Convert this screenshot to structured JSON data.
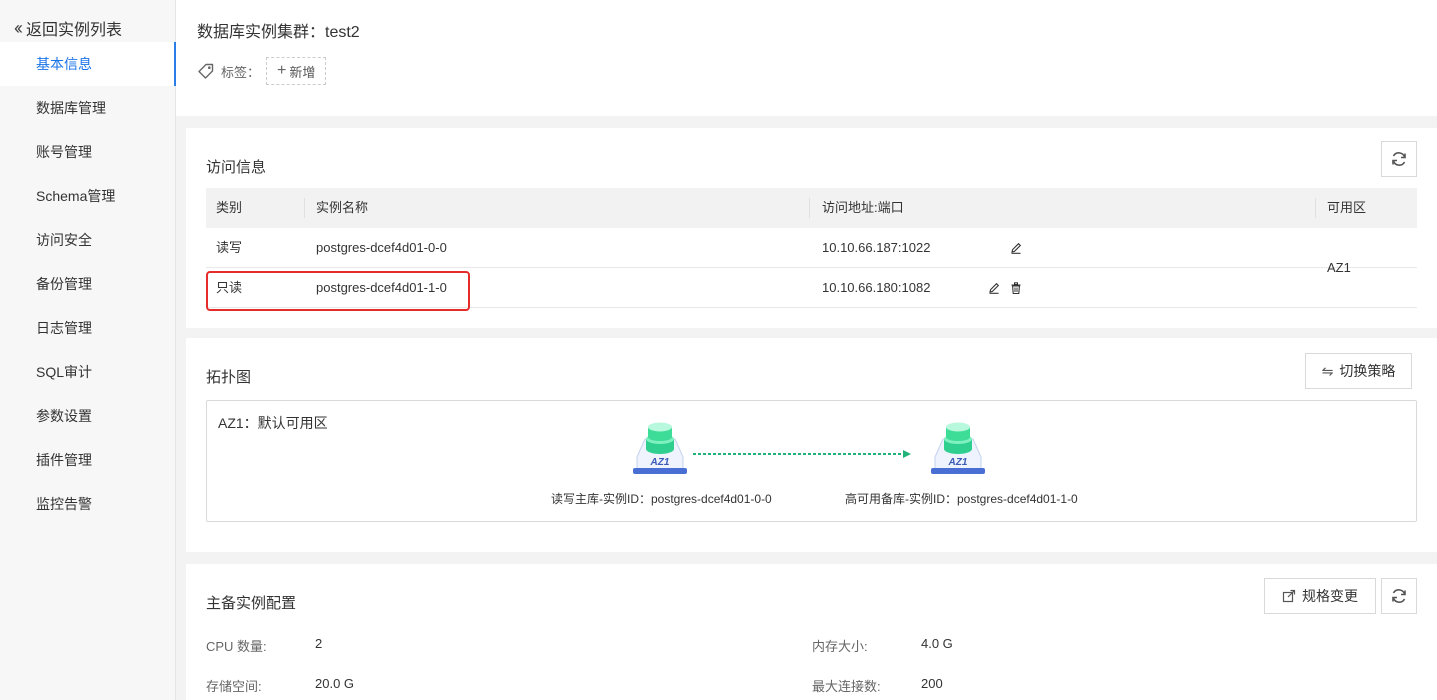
{
  "sidebar": {
    "back_label": "返回实例列表",
    "items": [
      {
        "label": "基本信息",
        "active": true
      },
      {
        "label": "数据库管理"
      },
      {
        "label": "账号管理"
      },
      {
        "label": "Schema管理"
      },
      {
        "label": "访问安全"
      },
      {
        "label": "备份管理"
      },
      {
        "label": "日志管理"
      },
      {
        "label": "SQL审计"
      },
      {
        "label": "参数设置"
      },
      {
        "label": "插件管理"
      },
      {
        "label": "监控告警"
      }
    ]
  },
  "header": {
    "title": "数据库实例集群：test2",
    "tag_label": "标签：",
    "add_tag_label": "新增"
  },
  "access": {
    "title": "访问信息",
    "columns": [
      "类别",
      "实例名称",
      "访问地址:端口",
      "可用区"
    ],
    "rows": [
      {
        "type": "读写",
        "name": "postgres-dcef4d01-0-0",
        "address": "10.10.66.187:1022"
      },
      {
        "type": "只读",
        "name": "postgres-dcef4d01-1-0",
        "address": "10.10.66.180:1082"
      }
    ],
    "zone": "AZ1"
  },
  "topology": {
    "title": "拓扑图",
    "switch_label": "切换策略",
    "zone_label": "AZ1：默认可用区",
    "node_badge": "AZ1",
    "primary_label": "读写主库-实例ID：postgres-dcef4d01-0-0",
    "standby_label": "高可用备库-实例ID：postgres-dcef4d01-1-0",
    "link_color": "#1fb37a"
  },
  "config": {
    "title": "主备实例配置",
    "change_label": "规格变更",
    "cpu_label": "CPU 数量:",
    "cpu_value": "2",
    "mem_label": "内存大小:",
    "mem_value": "4.0 G",
    "storage_label": "存储空间:",
    "storage_value": "20.0 G",
    "conn_label": "最大连接数:",
    "conn_value": "200"
  },
  "colors": {
    "accent": "#1a73e8",
    "highlight": "#e62b2b",
    "node_green": "#3ddc97"
  }
}
